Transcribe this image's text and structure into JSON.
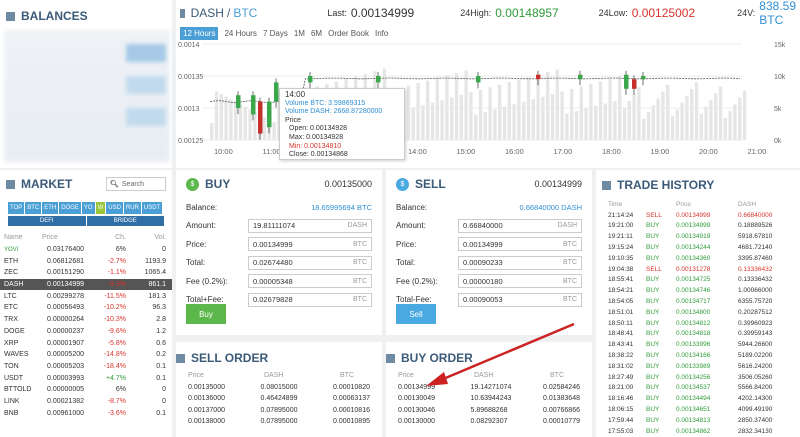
{
  "balances": {
    "title": "BALANCES"
  },
  "ticker": {
    "base": "DASH",
    "quote": "BTC",
    "last_label": "Last:",
    "last": "0.00134999",
    "high_label": "24High:",
    "high": "0.00148957",
    "low_label": "24Low:",
    "low": "0.00125002",
    "vol_label": "24V:",
    "vol": "838.59 BTC"
  },
  "timeframes": [
    "12 Hours",
    "24 Hours",
    "7 Days",
    "1M",
    "6M",
    "Order Book",
    "Info"
  ],
  "chart_data": {
    "type": "candlestick",
    "y_ticks": [
      "0.0014",
      "0.00135",
      "0.0013",
      "0.00125"
    ],
    "y_right_ticks": [
      "15k",
      "10k",
      "5k",
      "0k"
    ],
    "x_ticks": [
      "10:00",
      "11:00",
      "12:00",
      "13:00",
      "14:00",
      "15:00",
      "16:00",
      "17:00",
      "18:00",
      "19:00",
      "20:00",
      "21:00"
    ],
    "ylim": [
      0.00125,
      0.0014
    ],
    "tooltip": {
      "time": "14:00",
      "vol_btc": "Volume BTC: 3.59869315",
      "vol_dash": "Volume DASH: 2668.87280000",
      "price_label": "Price",
      "open": "Open: 0.00134928",
      "max": "Max: 0.00134928",
      "min": "Min: 0.00134810",
      "close": "Close: 0.00134868"
    }
  },
  "market": {
    "title": "MARKET",
    "search_placeholder": "Search",
    "tabs": [
      "TOP",
      "BTC",
      "ETH",
      "DOGE",
      "YO",
      "W",
      "USD",
      "RUR",
      "USDT"
    ],
    "tabs2": [
      "DEFI",
      "BRIDGE"
    ],
    "headers": [
      "Name",
      "Price",
      "Ch.",
      "Vol."
    ],
    "rows": [
      [
        "YOVI",
        "0.03176400",
        "6%",
        "0"
      ],
      [
        "ETH",
        "0.06812681",
        "-2.7%",
        "1193.9"
      ],
      [
        "ZEC",
        "0.00151290",
        "-1.1%",
        "1065.4"
      ],
      [
        "DASH",
        "0.00134999",
        "-9.3%",
        "861.1"
      ],
      [
        "LTC",
        "0.00299278",
        "-11.5%",
        "181.3"
      ],
      [
        "ETC",
        "0.00056493",
        "-10.2%",
        "96.3"
      ],
      [
        "TRX",
        "0.00000264",
        "-10.3%",
        "2.8"
      ],
      [
        "DOGE",
        "0.00000237",
        "-9.6%",
        "1.2"
      ],
      [
        "XRP",
        "0.00001907",
        "-5.8%",
        "0.6"
      ],
      [
        "WAVES",
        "0.00005200",
        "-14.8%",
        "0.2"
      ],
      [
        "TON",
        "0.00005203",
        "-18.4%",
        "0.1"
      ],
      [
        "USDT",
        "0.00003993",
        "+4.7%",
        "0.1"
      ],
      [
        "BTTOLD",
        "0.00000005",
        "6%",
        "0"
      ],
      [
        "LINK",
        "0.00021382",
        "-8.7%",
        "0"
      ],
      [
        "BNB",
        "0.00961000",
        "-3.6%",
        "0.1"
      ]
    ]
  },
  "buy": {
    "title": "BUY",
    "price": "0.00135000",
    "balance_label": "Balance:",
    "balance": "18.65995694 BTC",
    "fields": [
      {
        "label": "Amount:",
        "value": "19.81111074",
        "unit": "DASH"
      },
      {
        "label": "Price:",
        "value": "0.00134999",
        "unit": "BTC"
      },
      {
        "label": "Total:",
        "value": "0.02674480",
        "unit": "BTC"
      },
      {
        "label": "Fee (0.2%):",
        "value": "0.00005348",
        "unit": "BTC"
      },
      {
        "label": "Total+Fee:",
        "value": "0.02679828",
        "unit": "BTC"
      }
    ],
    "button": "Buy",
    "color": "#5cb84a"
  },
  "sell": {
    "title": "SELL",
    "price": "0.00134999",
    "balance_label": "Balance:",
    "balance": "0.66840000 DASH",
    "fields": [
      {
        "label": "Amount:",
        "value": "0.66840000",
        "unit": "DASH"
      },
      {
        "label": "Price:",
        "value": "0.00134999",
        "unit": "BTC"
      },
      {
        "label": "Total:",
        "value": "0.00090233",
        "unit": "BTC"
      },
      {
        "label": "Fee (0.2%):",
        "value": "0.00000180",
        "unit": "BTC"
      },
      {
        "label": "Total-Fee:",
        "value": "0.00090053",
        "unit": "BTC"
      }
    ],
    "button": "Sell",
    "color": "#4aa9e0"
  },
  "sell_order": {
    "title": "SELL ORDER",
    "headers": [
      "Price",
      "DASH",
      "BTC"
    ],
    "rows": [
      [
        "0.00135000",
        "0.08015000",
        "0.00010820"
      ],
      [
        "0.00136000",
        "0.46424899",
        "0.00063137"
      ],
      [
        "0.00137000",
        "0.07895000",
        "0.00010816"
      ],
      [
        "0.00138000",
        "0.07895000",
        "0.00010895"
      ]
    ]
  },
  "buy_order": {
    "title": "BUY ORDER",
    "headers": [
      "Price",
      "DASH",
      "BTC"
    ],
    "rows": [
      [
        "0.00134999",
        "19.14271074",
        "0.02584246"
      ],
      [
        "0.00130049",
        "10.63944243",
        "0.01383648"
      ],
      [
        "0.00130046",
        "5.89688268",
        "0.00766866"
      ],
      [
        "0.00130000",
        "0.08292307",
        "0.00010779"
      ]
    ]
  },
  "trade_history": {
    "title": "TRADE HISTORY",
    "headers": [
      "Time",
      "",
      "Price",
      "DASH"
    ],
    "rows": [
      [
        "21:14:24",
        "SELL",
        "0.00134999",
        "0.66840000"
      ],
      [
        "19:21:00",
        "BUY",
        "0.00134999",
        "0.18889526"
      ],
      [
        "19:21:11",
        "BUY",
        "0.00134919",
        "5918.67810"
      ],
      [
        "19:15:24",
        "BUY",
        "0.00134244",
        "4681.72140"
      ],
      [
        "19:10:35",
        "BUY",
        "0.00134360",
        "3395.87460"
      ],
      [
        "19:04:38",
        "SELL",
        "0.00131278",
        "0.13336432"
      ],
      [
        "18:55:41",
        "BUY",
        "0.00134725",
        "0.13336432"
      ],
      [
        "18:54:21",
        "BUY",
        "0.00134746",
        "1.00066000"
      ],
      [
        "18:54:05",
        "BUY",
        "0.00134717",
        "6355.75720"
      ],
      [
        "18:51:01",
        "BUY",
        "0.00134800",
        "0.20287512"
      ],
      [
        "18:50:11",
        "BUY",
        "0.00134812",
        "0.39960923"
      ],
      [
        "18:48:41",
        "BUY",
        "0.00134818",
        "0.39959143"
      ],
      [
        "18:43:41",
        "BUY",
        "0.00133996",
        "5944.26600"
      ],
      [
        "18:38:22",
        "BUY",
        "0.00134166",
        "5189.02200"
      ],
      [
        "18:31:02",
        "BUY",
        "0.00133989",
        "5616.24200"
      ],
      [
        "18:27:49",
        "BUY",
        "0.00134256",
        "3506.05260"
      ],
      [
        "18:21:00",
        "BUY",
        "0.00134537",
        "5566.84200"
      ],
      [
        "18:16:46",
        "BUY",
        "0.00134494",
        "4202.14300"
      ],
      [
        "18:06:15",
        "BUY",
        "0.00134651",
        "4099.49190"
      ],
      [
        "17:59:44",
        "BUY",
        "0.00134813",
        "2850.37400"
      ],
      [
        "17:55:03",
        "BUY",
        "0.00134862",
        "2832.34130"
      ]
    ]
  },
  "colors": {
    "buy": "#2e9c39",
    "sell": "#d9342b",
    "accent": "#4a9fd6"
  }
}
